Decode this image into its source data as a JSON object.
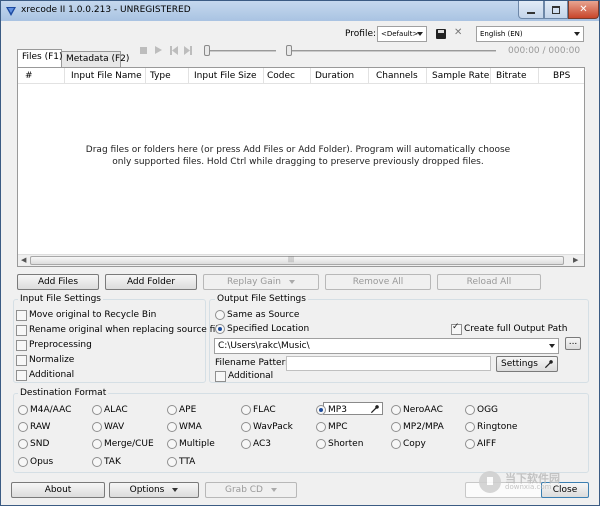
{
  "window": {
    "title": "xrecode II 1.0.0.213 - UNREGISTERED"
  },
  "profile": {
    "label": "Profile:",
    "value": "<Default>"
  },
  "language": {
    "value": "English (EN)"
  },
  "tabs": [
    {
      "label": "Files (F1)"
    },
    {
      "label": "Metadata (F2)"
    }
  ],
  "player": {
    "time": "000:00 / 000:00"
  },
  "file_list": {
    "columns": [
      "#",
      "Input File Name",
      "Type",
      "Input File Size",
      "Codec",
      "Duration",
      "Channels",
      "Sample Rate",
      "Bitrate",
      "BPS"
    ],
    "drop_hint_line1": "Drag files or folders here (or press Add Files or Add Folder). Program will automatically choose",
    "drop_hint_line2": "only supported files. Hold Ctrl while dragging to preserve previously dropped files."
  },
  "actions": {
    "add_files": "Add Files",
    "add_folder": "Add Folder",
    "replay_gain": "Replay Gain",
    "remove_all": "Remove All",
    "reload_all": "Reload All"
  },
  "input_settings": {
    "title": "Input File Settings",
    "options": [
      "Move original to Recycle Bin",
      "Rename original when replacing source file",
      "Preprocessing",
      "Normalize",
      "Additional"
    ]
  },
  "output_settings": {
    "title": "Output File Settings",
    "same_as_source": "Same as Source",
    "specified_location": "Specified Location",
    "create_full_path": "Create full Output Path",
    "path": "C:\\Users\\rakc\\Music\\",
    "browse": "...",
    "filename_pattern": "Filename Pattern:",
    "settings": "Settings",
    "additional": "Additional"
  },
  "destination": {
    "title": "Destination Format",
    "selected": "MP3",
    "formats": [
      "M4A/AAC",
      "ALAC",
      "APE",
      "FLAC",
      "MP3",
      "NeroAAC",
      "OGG",
      "RAW",
      "WAV",
      "WMA",
      "WavPack",
      "MPC",
      "MP2/MPA",
      "Ringtone",
      "SND",
      "Merge/CUE",
      "Multiple",
      "AC3",
      "Shorten",
      "Copy",
      "AIFF",
      "Opus",
      "TAK",
      "TTA"
    ]
  },
  "footer": {
    "about": "About",
    "options": "Options",
    "grab_cd": "Grab CD",
    "close": "Close"
  },
  "watermark": {
    "line1": "当下软件园",
    "line2": "downxia.com"
  }
}
